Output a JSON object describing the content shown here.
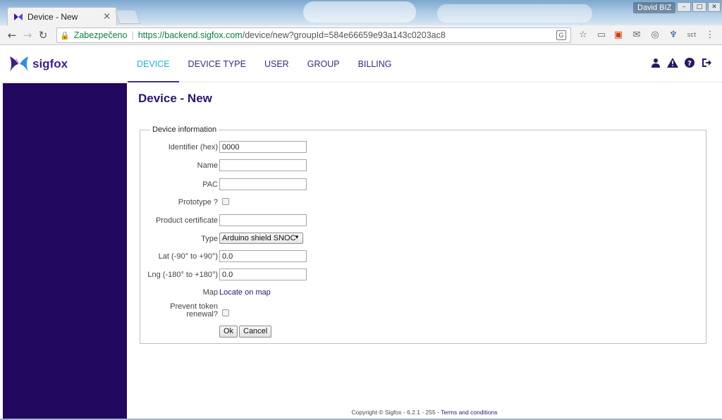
{
  "browser": {
    "tab_title": "Device - New",
    "tab_close": "×",
    "user_name": "David BIZ",
    "secure_label": "Zabezpečeno",
    "url_host": "https://backend.sigfox.com",
    "url_path": "/device/new?groupId=584e66659e93a143c0203ac8"
  },
  "brand": {
    "name": "sigfox",
    "color": "#3f1f86"
  },
  "nav": {
    "items": [
      {
        "label": "DEVICE",
        "active": true
      },
      {
        "label": "DEVICE TYPE"
      },
      {
        "label": "USER"
      },
      {
        "label": "GROUP"
      },
      {
        "label": "BILLING"
      }
    ]
  },
  "header_icons": [
    "user-icon",
    "warning-icon",
    "help-icon",
    "logout-icon"
  ],
  "page": {
    "title": "Device - New"
  },
  "form": {
    "legend": "Device information",
    "identifier": {
      "label": "Identifier (hex)",
      "value": "0000"
    },
    "name": {
      "label": "Name",
      "value": ""
    },
    "pac": {
      "label": "PAC",
      "value": ""
    },
    "prototype": {
      "label": "Prototype ?",
      "checked": false
    },
    "product_certificate": {
      "label": "Product certificate",
      "value": ""
    },
    "type": {
      "label": "Type",
      "value": "Arduino shield SNOC"
    },
    "lat": {
      "label": "Lat (-90° to +90°)",
      "value": "0.0"
    },
    "lng": {
      "label": "Lng (-180° to +180°)",
      "value": "0.0"
    },
    "map": {
      "label": "Map",
      "link": "Locate on map"
    },
    "prevent_token": {
      "label_line1": "Prevent token",
      "label_line2": "renewal?",
      "checked": false
    },
    "ok_label": "Ok",
    "cancel_label": "Cancel"
  },
  "footer": {
    "text": "Copyright © Sigfox - 6.2.1 - 255 - ",
    "link": "Terms and conditions"
  },
  "colors": {
    "sidebar": "#22075e",
    "active_nav": "#1fb3cc",
    "nav_text": "#3a2a78"
  }
}
